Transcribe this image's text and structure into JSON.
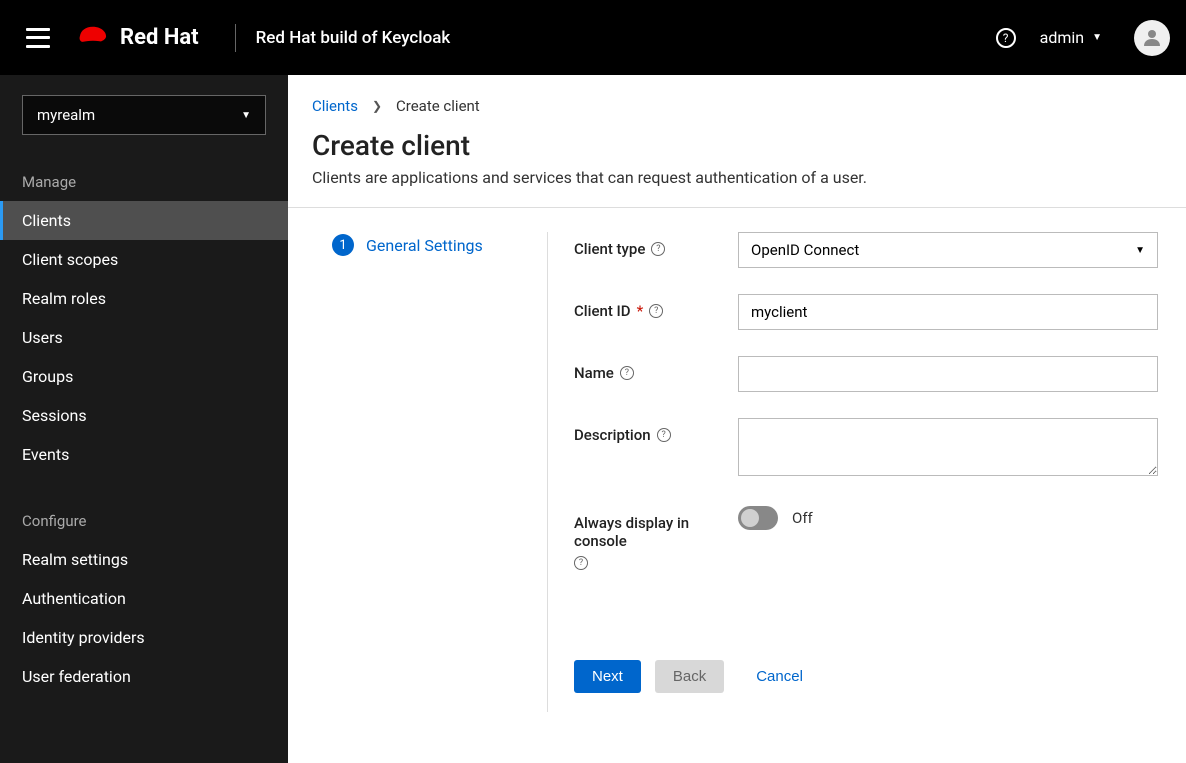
{
  "header": {
    "brand": "Red Hat",
    "product": "Red Hat build of Keycloak",
    "user": "admin"
  },
  "sidebar": {
    "realm": "myrealm",
    "sections": [
      {
        "label": "Manage",
        "items": [
          {
            "label": "Clients",
            "active": true
          },
          {
            "label": "Client scopes"
          },
          {
            "label": "Realm roles"
          },
          {
            "label": "Users"
          },
          {
            "label": "Groups"
          },
          {
            "label": "Sessions"
          },
          {
            "label": "Events"
          }
        ]
      },
      {
        "label": "Configure",
        "items": [
          {
            "label": "Realm settings"
          },
          {
            "label": "Authentication"
          },
          {
            "label": "Identity providers"
          },
          {
            "label": "User federation"
          }
        ]
      }
    ]
  },
  "breadcrumb": {
    "parent": "Clients",
    "current": "Create client"
  },
  "page": {
    "title": "Create client",
    "description": "Clients are applications and services that can request authentication of a user."
  },
  "wizard": {
    "step_number": "1",
    "step_label": "General Settings"
  },
  "form": {
    "client_type_label": "Client type",
    "client_type_value": "OpenID Connect",
    "client_id_label": "Client ID",
    "client_id_value": "myclient",
    "name_label": "Name",
    "name_value": "",
    "description_label": "Description",
    "description_value": "",
    "always_display_label": "Always display in console",
    "always_display_state": "Off"
  },
  "actions": {
    "next": "Next",
    "back": "Back",
    "cancel": "Cancel"
  }
}
